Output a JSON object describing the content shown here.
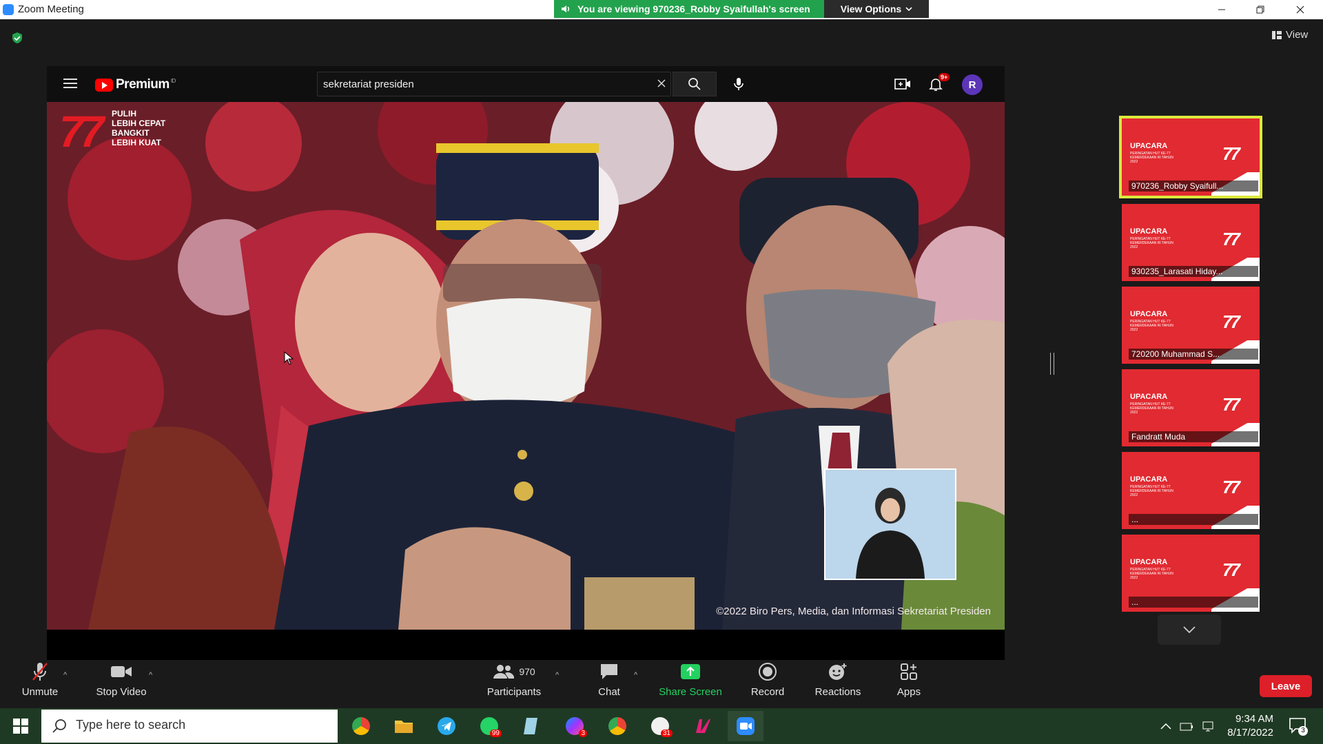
{
  "window": {
    "title": "Zoom Meeting",
    "share_banner": "You are viewing 970236_Robby Syaifullah's screen",
    "view_options": "View Options",
    "view_label": "View"
  },
  "youtube": {
    "logo_text": "Premium",
    "logo_region": "ID",
    "search_value": "sekretariat presiden",
    "notification_badge": "9+",
    "avatar_letter": "R"
  },
  "video": {
    "slogan_lines": [
      "PULIH",
      "LEBIH CEPAT",
      "BANGKIT",
      "LEBIH KUAT"
    ],
    "copyright": "©2022 Biro Pers, Media, dan Informasi Sekretariat Presiden"
  },
  "thumbnails": [
    {
      "name": "970236_Robby Syaifull...",
      "title": "UPACARA",
      "active": true
    },
    {
      "name": "930235_Larasati Hiday...",
      "title": "UPACARA",
      "active": false
    },
    {
      "name": "720200 Muhammad S...",
      "title": "UPACARA",
      "active": false
    },
    {
      "name": "Fandratt Muda",
      "title": "UPACARA",
      "active": false
    },
    {
      "name": "...",
      "title": "UPACARA",
      "active": false
    },
    {
      "name": "...",
      "title": "UPACARA",
      "active": false
    }
  ],
  "thumb_sub": "PERINGATAN HUT KE-77 KEMERDEKAAN RI TAHUN 2022",
  "thumb_77": "77",
  "toolbar": {
    "unmute": "Unmute",
    "stop_video": "Stop Video",
    "participants": "Participants",
    "participant_count": "970",
    "chat": "Chat",
    "share_screen": "Share Screen",
    "record": "Record",
    "reactions": "Reactions",
    "apps": "Apps",
    "leave": "Leave"
  },
  "taskbar": {
    "search_placeholder": "Type here to search",
    "time": "9:34 AM",
    "date": "8/17/2022",
    "notification_count": "3",
    "whatsapp_badge": "99",
    "messenger_badge": "3",
    "app_badge": "31"
  },
  "colors": {
    "zoom_blue": "#2d8cff",
    "share_green": "#23a24d",
    "leave_red": "#dd1f29",
    "yt_red": "#ff0000",
    "active_thumb_border": "#dce83c"
  }
}
